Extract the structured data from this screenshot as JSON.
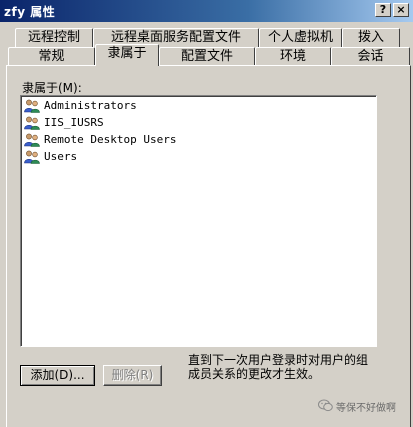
{
  "window": {
    "title": "zfy 属性",
    "help_glyph": "?",
    "close_glyph": "×"
  },
  "tabs": {
    "row_back": [
      "远程控制",
      "远程桌面服务配置文件",
      "个人虚拟机",
      "拨入"
    ],
    "row_front": [
      "常规",
      "隶属于",
      "配置文件",
      "环境",
      "会话"
    ],
    "active": "隶属于"
  },
  "memberof": {
    "label": "隶属于(M):",
    "groups": [
      "Administrators",
      "IIS_IUSRS",
      "Remote Desktop Users",
      "Users"
    ],
    "group_icon": "users-group-icon"
  },
  "buttons": {
    "add": "添加(D)...",
    "remove": "删除(R)"
  },
  "note": "直到下一次用户登录时对用户的组成员关系的更改才生效。",
  "watermark": {
    "text": "等保不好做啊",
    "icon": "wechat-icon"
  },
  "colors": {
    "window_bg": "#d4d0c8",
    "title_bar": "#0a246a",
    "list_bg": "#ffffff"
  }
}
